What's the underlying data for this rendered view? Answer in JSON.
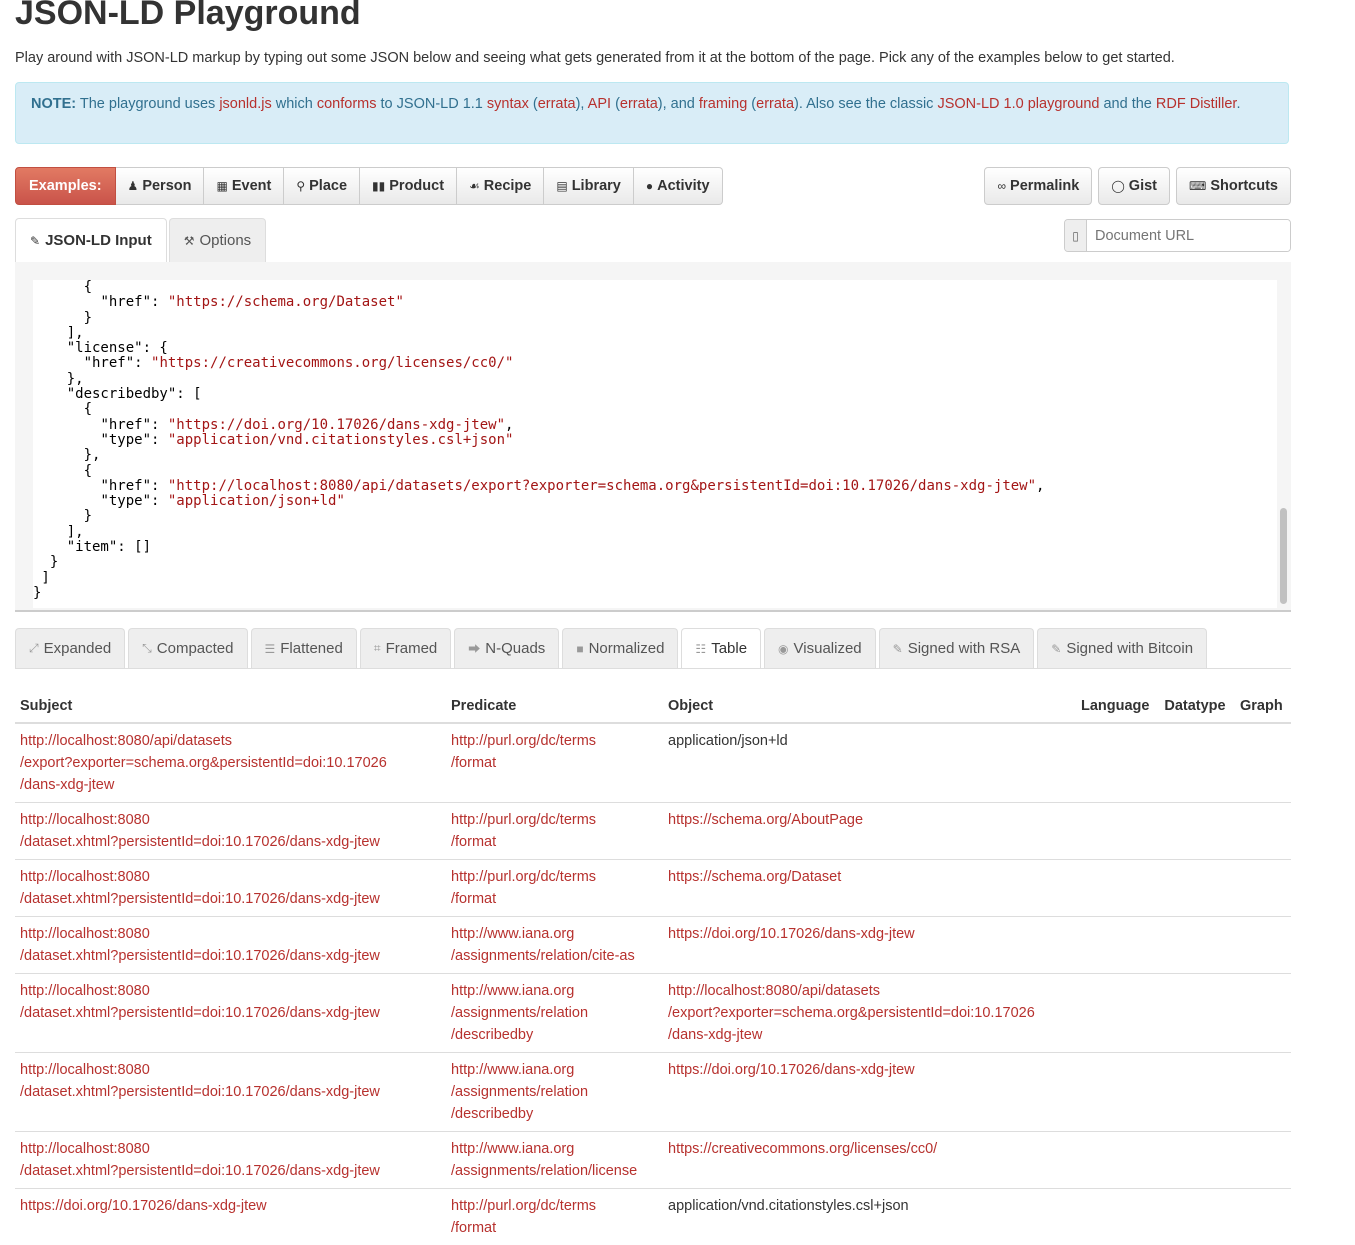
{
  "page": {
    "title": "JSON-LD Playground",
    "lead": "Play around with JSON-LD markup by typing out some JSON below and seeing what gets generated from it at the bottom of the page. Pick any of the examples below to get started."
  },
  "note": {
    "label": "NOTE:",
    "t1": " The playground uses ",
    "l1": "jsonld.js",
    "t2": " which ",
    "l2": "conforms",
    "t3": " to JSON-LD 1.1 ",
    "l3": "syntax",
    "t4": " (",
    "l4": "errata",
    "t5": "), ",
    "l5": "API",
    "t6": " (",
    "l6": "errata",
    "t7": "), and ",
    "l7": "framing",
    "t8": " (",
    "l8": "errata",
    "t9": "). Also see the classic ",
    "l9": "JSON-LD 1.0 playground",
    "t10": " and the ",
    "l10": "RDF Distiller",
    "t11": "."
  },
  "examples": {
    "label": "Examples:",
    "items": [
      {
        "icon": "person-icon",
        "label": "Person"
      },
      {
        "icon": "calendar-icon",
        "label": "Event"
      },
      {
        "icon": "map-marker-icon",
        "label": "Place"
      },
      {
        "icon": "barcode-icon",
        "label": "Product"
      },
      {
        "icon": "cutlery-icon",
        "label": "Recipe"
      },
      {
        "icon": "book-icon",
        "label": "Library"
      },
      {
        "icon": "comment-icon",
        "label": "Activity"
      }
    ]
  },
  "actions": {
    "permalink": "Permalink",
    "gist": "Gist",
    "shortcuts": "Shortcuts"
  },
  "input_tabs": {
    "input": "JSON-LD Input",
    "options": "Options"
  },
  "document_url": {
    "placeholder": "Document URL"
  },
  "editor_lines": [
    "      {",
    "        \"href\": \"https://schema.org/Dataset\"",
    "      }",
    "    ],",
    "    \"license\": {",
    "      \"href\": \"https://creativecommons.org/licenses/cc0/\"",
    "    },",
    "    \"describedby\": [",
    "      {",
    "        \"href\": \"https://doi.org/10.17026/dans-xdg-jtew\",",
    "        \"type\": \"application/vnd.citationstyles.csl+json\"",
    "      },",
    "      {",
    "        \"href\": \"http://localhost:8080/api/datasets/export?exporter=schema.org&persistentId=doi:10.17026/dans-xdg-jtew\",",
    "        \"type\": \"application/json+ld\"",
    "      }",
    "    ],",
    "    \"item\": []",
    "  }",
    " ]",
    "}"
  ],
  "output_tabs": [
    {
      "icon": "expand-icon",
      "label": "Expanded"
    },
    {
      "icon": "compress-icon",
      "label": "Compacted"
    },
    {
      "icon": "list-icon",
      "label": "Flattened"
    },
    {
      "icon": "crop-icon",
      "label": "Framed"
    },
    {
      "icon": "share-icon",
      "label": "N-Quads"
    },
    {
      "icon": "stop-icon",
      "label": "Normalized"
    },
    {
      "icon": "table-icon",
      "label": "Table"
    },
    {
      "icon": "eye-icon",
      "label": "Visualized"
    },
    {
      "icon": "pencil-icon",
      "label": "Signed with RSA"
    },
    {
      "icon": "pencil-icon",
      "label": "Signed with Bitcoin"
    }
  ],
  "table": {
    "headers": [
      "Subject",
      "Predicate",
      "Object",
      "Language",
      "Datatype",
      "Graph"
    ],
    "rows": [
      {
        "subject": [
          "http://localhost:8080/api/datasets",
          "/export?exporter=schema.org&persistentId=doi:10.17026",
          "/dans-xdg-jtew"
        ],
        "predicate": [
          "http://purl.org/dc/terms",
          "/format"
        ],
        "object": [
          "application/json+ld"
        ],
        "object_link": false
      },
      {
        "subject": [
          "http://localhost:8080",
          "/dataset.xhtml?persistentId=doi:10.17026/dans-xdg-jtew"
        ],
        "predicate": [
          "http://purl.org/dc/terms",
          "/format"
        ],
        "object": [
          "https://schema.org/AboutPage"
        ],
        "object_link": true
      },
      {
        "subject": [
          "http://localhost:8080",
          "/dataset.xhtml?persistentId=doi:10.17026/dans-xdg-jtew"
        ],
        "predicate": [
          "http://purl.org/dc/terms",
          "/format"
        ],
        "object": [
          "https://schema.org/Dataset"
        ],
        "object_link": true
      },
      {
        "subject": [
          "http://localhost:8080",
          "/dataset.xhtml?persistentId=doi:10.17026/dans-xdg-jtew"
        ],
        "predicate": [
          "http://www.iana.org",
          "/assignments/relation/cite-as"
        ],
        "object": [
          "https://doi.org/10.17026/dans-xdg-jtew"
        ],
        "object_link": true
      },
      {
        "subject": [
          "http://localhost:8080",
          "/dataset.xhtml?persistentId=doi:10.17026/dans-xdg-jtew"
        ],
        "predicate": [
          "http://www.iana.org",
          "/assignments/relation",
          "/describedby"
        ],
        "object": [
          "http://localhost:8080/api/datasets",
          "/export?exporter=schema.org&persistentId=doi:10.17026",
          "/dans-xdg-jtew"
        ],
        "object_link": true
      },
      {
        "subject": [
          "http://localhost:8080",
          "/dataset.xhtml?persistentId=doi:10.17026/dans-xdg-jtew"
        ],
        "predicate": [
          "http://www.iana.org",
          "/assignments/relation",
          "/describedby"
        ],
        "object": [
          "https://doi.org/10.17026/dans-xdg-jtew"
        ],
        "object_link": true
      },
      {
        "subject": [
          "http://localhost:8080",
          "/dataset.xhtml?persistentId=doi:10.17026/dans-xdg-jtew"
        ],
        "predicate": [
          "http://www.iana.org",
          "/assignments/relation/license"
        ],
        "object": [
          "https://creativecommons.org/licenses/cc0/"
        ],
        "object_link": true
      },
      {
        "subject": [
          "https://doi.org/10.17026/dans-xdg-jtew"
        ],
        "predicate": [
          "http://purl.org/dc/terms",
          "/format"
        ],
        "object": [
          "application/vnd.citationstyles.csl+json"
        ],
        "object_link": false
      }
    ]
  },
  "colors": {
    "link": "#b7312e",
    "note_bg": "#d9edf7",
    "note_text": "#31708f",
    "examples_label_bg": "#d9534f",
    "string": "#a31515"
  }
}
